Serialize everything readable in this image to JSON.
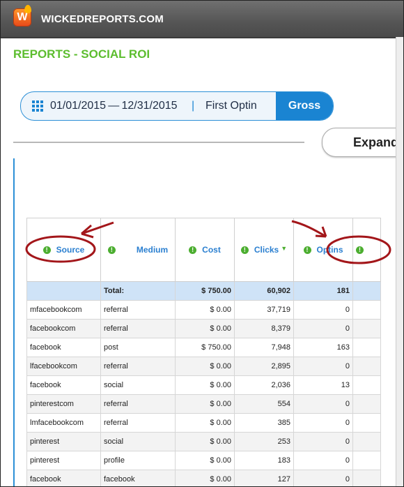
{
  "app": {
    "brand": "WICKEDREPORTS.COM",
    "logo_letter": "W"
  },
  "page": {
    "title": "REPORTS - SOCIAL ROI"
  },
  "filters": {
    "date_range": "01/01/2015 — 12/31/2015",
    "separator": "|",
    "attribution": "First Optin",
    "revenue_mode": "Gross"
  },
  "actions": {
    "expand_label": "Expand"
  },
  "table": {
    "columns": [
      "Source",
      "Medium",
      "Cost",
      "Clicks",
      "Optins"
    ],
    "total": {
      "label": "Total:",
      "cost": "$ 750.00",
      "clicks": "60,902",
      "optins": "181"
    },
    "rows": [
      {
        "source": "mfacebookcom",
        "medium": "referral",
        "cost": "$ 0.00",
        "clicks": "37,719",
        "optins": "0"
      },
      {
        "source": "facebookcom",
        "medium": "referral",
        "cost": "$ 0.00",
        "clicks": "8,379",
        "optins": "0"
      },
      {
        "source": "facebook",
        "medium": "post",
        "cost": "$ 750.00",
        "clicks": "7,948",
        "optins": "163"
      },
      {
        "source": "lfacebookcom",
        "medium": "referral",
        "cost": "$ 0.00",
        "clicks": "2,895",
        "optins": "0"
      },
      {
        "source": "facebook",
        "medium": "social",
        "cost": "$ 0.00",
        "clicks": "2,036",
        "optins": "13"
      },
      {
        "source": "pinterestcom",
        "medium": "referral",
        "cost": "$ 0.00",
        "clicks": "554",
        "optins": "0"
      },
      {
        "source": "lmfacebookcom",
        "medium": "referral",
        "cost": "$ 0.00",
        "clicks": "385",
        "optins": "0"
      },
      {
        "source": "pinterest",
        "medium": "social",
        "cost": "$ 0.00",
        "clicks": "253",
        "optins": "0"
      },
      {
        "source": "pinterest",
        "medium": "profile",
        "cost": "$ 0.00",
        "clicks": "183",
        "optins": "0"
      },
      {
        "source": "facebook",
        "medium": "facebook",
        "cost": "$ 0.00",
        "clicks": "127",
        "optins": "0"
      }
    ]
  },
  "colors": {
    "accent_blue": "#1a84d2",
    "title_green": "#5cbd2e",
    "annotation_red": "#a3161a"
  }
}
